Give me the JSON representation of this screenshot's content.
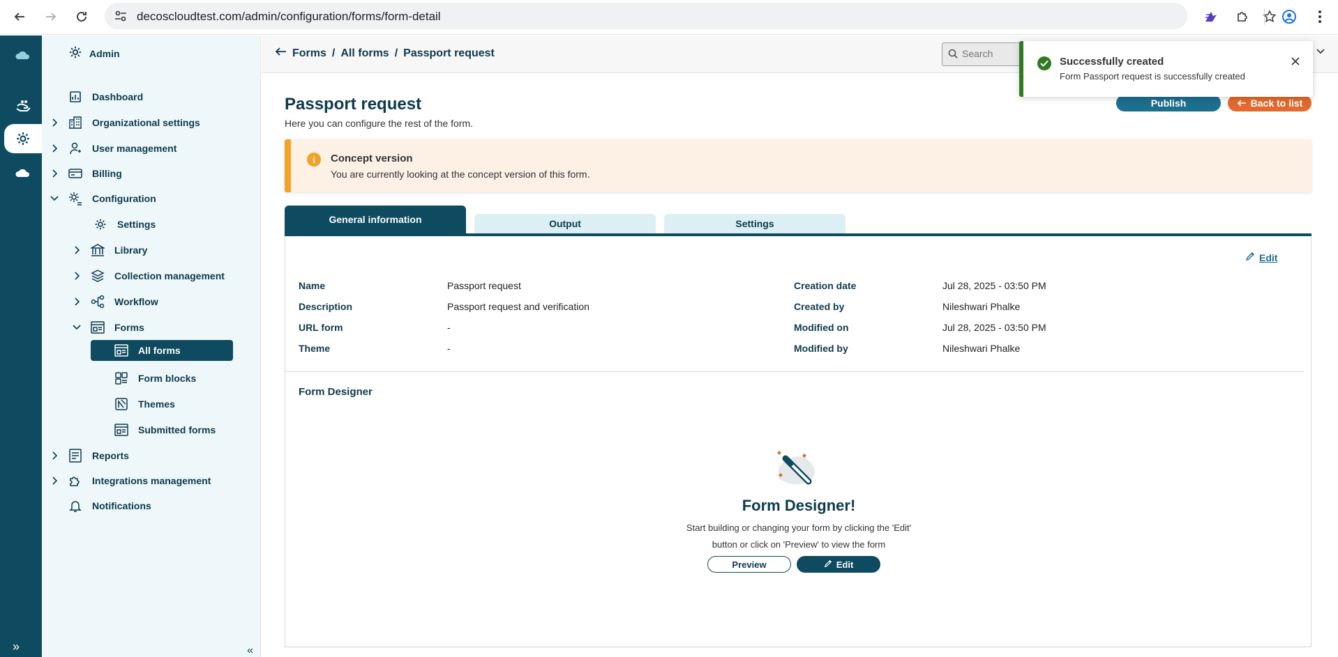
{
  "browser": {
    "url": "decoscloudtest.com/admin/configuration/forms/form-detail"
  },
  "sidebar": {
    "header": "Admin",
    "items": [
      {
        "label": "Dashboard",
        "icon": "dashboard-icon"
      },
      {
        "label": "Organizational settings",
        "icon": "building-icon"
      },
      {
        "label": "User management",
        "icon": "user-icon"
      },
      {
        "label": "Billing",
        "icon": "card-icon"
      },
      {
        "label": "Configuration",
        "icon": "config-icon"
      },
      {
        "label": "Settings",
        "icon": "gear-icon"
      },
      {
        "label": "Library",
        "icon": "library-icon"
      },
      {
        "label": "Collection management",
        "icon": "layers-icon"
      },
      {
        "label": "Workflow",
        "icon": "workflow-icon"
      },
      {
        "label": "Forms",
        "icon": "form-icon"
      },
      {
        "label": "All forms",
        "icon": "form-icon"
      },
      {
        "label": "Form blocks",
        "icon": "blocks-icon"
      },
      {
        "label": "Themes",
        "icon": "theme-icon"
      },
      {
        "label": "Submitted forms",
        "icon": "form-icon"
      },
      {
        "label": "Reports",
        "icon": "report-icon"
      },
      {
        "label": "Integrations management",
        "icon": "puzzle-icon"
      },
      {
        "label": "Notifications",
        "icon": "bell-icon"
      }
    ]
  },
  "header": {
    "breadcrumb": [
      "Forms",
      "/",
      "All forms",
      "/",
      "Passport request"
    ],
    "search_placeholder": "Search"
  },
  "toast": {
    "title": "Successfully created",
    "message": "Form Passport request is successfully created"
  },
  "page": {
    "title": "Passport request",
    "subtitle": "Here you can configure the rest of the form.",
    "publish_label": "Publish",
    "back_label": "Back to list"
  },
  "banner": {
    "title": "Concept version",
    "message": "You are currently looking at the concept version of this form."
  },
  "tabs": [
    "General information",
    "Output",
    "Settings"
  ],
  "general": {
    "edit_label": "Edit",
    "left": [
      {
        "label": "Name",
        "value": "Passport request"
      },
      {
        "label": "Description",
        "value": "Passport request and verification"
      },
      {
        "label": "URL form",
        "value": "-"
      },
      {
        "label": "Theme",
        "value": "-"
      }
    ],
    "right": [
      {
        "label": "Creation date",
        "value": "Jul 28, 2025 - 03:50 PM"
      },
      {
        "label": "Created by",
        "value": "Nileshwari Phalke"
      },
      {
        "label": "Modified on",
        "value": "Jul 28, 2025 - 03:50 PM"
      },
      {
        "label": "Modified by",
        "value": "Nileshwari Phalke"
      }
    ]
  },
  "designer": {
    "heading": "Form Designer",
    "title": "Form Designer!",
    "desc_line1": "Start building or changing your form by clicking the 'Edit'",
    "desc_line2": "button or click on 'Preview' to view the form",
    "preview_label": "Preview",
    "edit_label": "Edit"
  },
  "colors": {
    "primary": "#0e4a60",
    "accent_orange": "#e36a2e",
    "success": "#2f7a1f",
    "warning": "#f0a326"
  }
}
